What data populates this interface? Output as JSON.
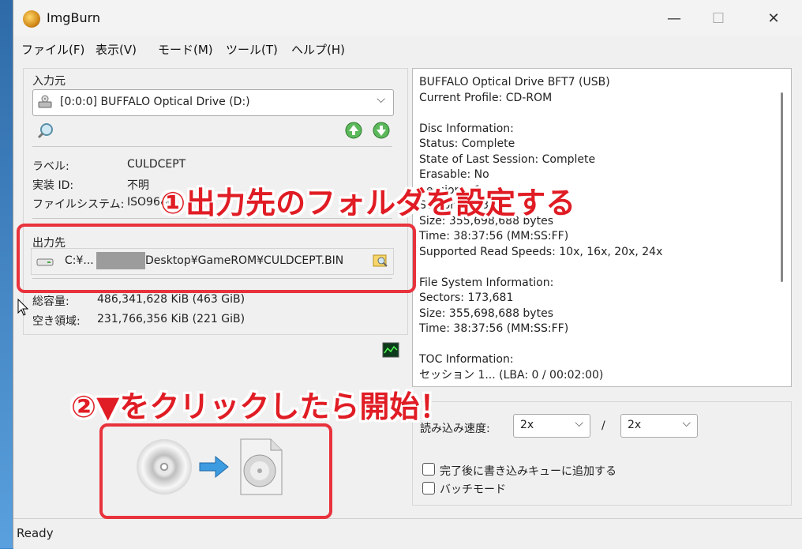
{
  "window": {
    "title": "ImgBurn",
    "controls": {
      "minimize": "—",
      "maximize": "☐",
      "close": "✕"
    }
  },
  "menu": [
    "ファイル(F)",
    "表示(V)",
    "モード(M)",
    "ツール(T)",
    "ヘルプ(H)"
  ],
  "source": {
    "section_label": "入力元",
    "drive": "[0:0:0] BUFFALO Optical Drive (D:)",
    "label_key": "ラベル:",
    "label_value": "CULDCEPT",
    "impl_id_key": "実装 ID:",
    "impl_id_value": "不明",
    "fs_key": "ファイルシステム:",
    "fs_value": "ISO9660"
  },
  "destination": {
    "section_label": "出力先",
    "path_prefix": "C:¥...",
    "path_suffix": "Desktop¥GameROM¥CULDCEPT.BIN"
  },
  "capacity": {
    "total_key": "総容量:",
    "total_value": "486,341,628 KiB  (463 GiB)",
    "free_key": "空き領域:",
    "free_value": "231,766,356 KiB  (221 GiB)"
  },
  "info_panel": {
    "text": "BUFFALO Optical Drive BFT7 (USB)\nCurrent Profile: CD-ROM\n\nDisc Information:\nStatus: Complete\nState of Last Session: Complete\nErasable: No\nSessions: 1\nSectors: 173,681\nSize: 355,698,688 bytes\nTime: 38:37:56 (MM:SS:FF)\nSupported Read Speeds: 10x, 16x, 20x, 24x\n\nFile System Information:\nSectors: 173,681\nSize: 355,698,688 bytes\nTime: 38:37:56 (MM:SS:FF)\n\nTOC Information:\nセッション 1... (LBA: 0 / 00:02:00)"
  },
  "settings": {
    "read_speed_label": "読み込み速度:",
    "read_speed_value": "2x",
    "slash": "/",
    "write_speed_value": "2x",
    "queue_checkbox_label": "完了後に書き込みキューに追加する",
    "batch_checkbox_label": "バッチモード"
  },
  "status_bar": {
    "text": "Ready"
  },
  "annotations": {
    "step1": "①出力先のフォルダを設定する",
    "step2": "②▼をクリックしたら開始！",
    "color": "#e8323c"
  }
}
